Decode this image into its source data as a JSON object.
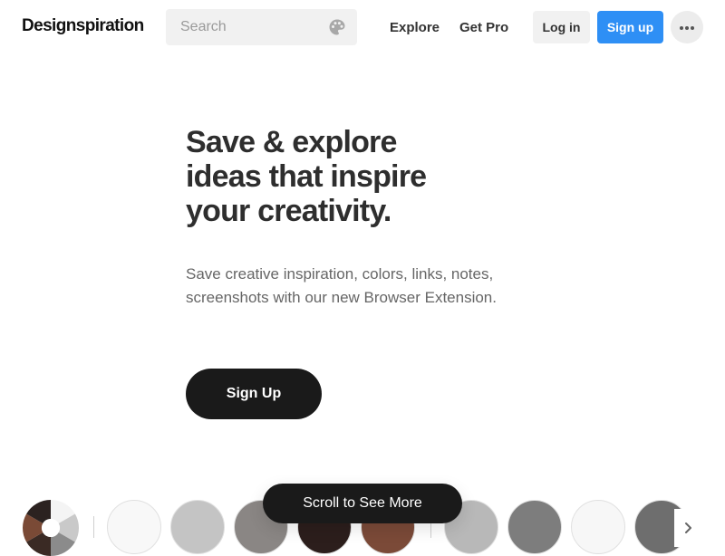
{
  "header": {
    "logo": "Designspiration",
    "search_placeholder": "Search",
    "nav": {
      "explore": "Explore",
      "get_pro": "Get Pro"
    },
    "login": "Log in",
    "signup": "Sign up"
  },
  "hero": {
    "headline_lines": [
      "Save & explore",
      "ideas that inspire",
      "your creativity."
    ],
    "subtext_lines": [
      "Save creative inspiration, colors, links, notes,",
      "screenshots with our new Browser Extension."
    ],
    "cta": "Sign Up"
  },
  "scroll_hint": "Scroll to See More",
  "colors": {
    "accent": "#2e8ff5",
    "wheel": [
      "#f4f4f4",
      "#c9c9c9",
      "#8b8b8b",
      "#3a2a24",
      "#7a4a36",
      "#2b2220"
    ],
    "swatches": [
      "#f8f8f8",
      "#c4c4c4",
      "#8a8684",
      "#2c1e1c",
      "#7b4a38",
      "#b8b8b8",
      "#7d7d7d",
      "#f7f7f7",
      "#6e6e6e"
    ]
  },
  "icons": [
    "palette-icon",
    "more-icon",
    "chevron-right-icon"
  ]
}
